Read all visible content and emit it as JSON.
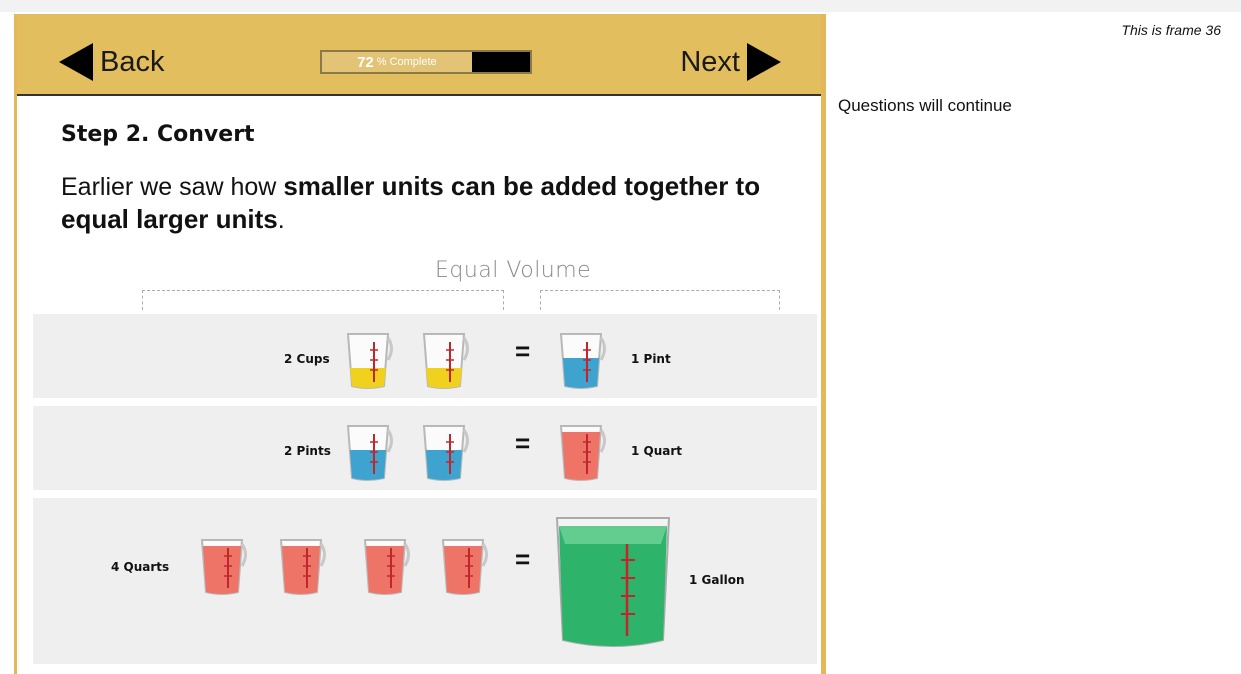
{
  "frame_note": "This is frame 36",
  "side_text": "Questions will continue",
  "nav": {
    "back_label": "Back",
    "next_label": "Next"
  },
  "progress": {
    "percent_label": "72",
    "suffix": "% Complete",
    "fraction": 0.72
  },
  "content": {
    "step_title": "Step 2. Convert",
    "intro_plain_1": "Earlier we saw how ",
    "intro_bold": "smaller units can be added together to equal larger units",
    "intro_plain_2": ".",
    "equal_volume": "Equal Volume",
    "equals_sign": "="
  },
  "rows": [
    {
      "left_label": "2 Cups",
      "right_label": "1 Pint"
    },
    {
      "left_label": "2 Pints",
      "right_label": "1 Quart"
    },
    {
      "left_label": "4 Quarts",
      "right_label": "1 Gallon"
    }
  ],
  "colors": {
    "accent": "#e2be5e",
    "cup_liquid": "#f0d21e",
    "pint_liquid": "#3fa3d0",
    "quart_liquid": "#ef7468",
    "gallon_liquid": "#2db36a"
  }
}
